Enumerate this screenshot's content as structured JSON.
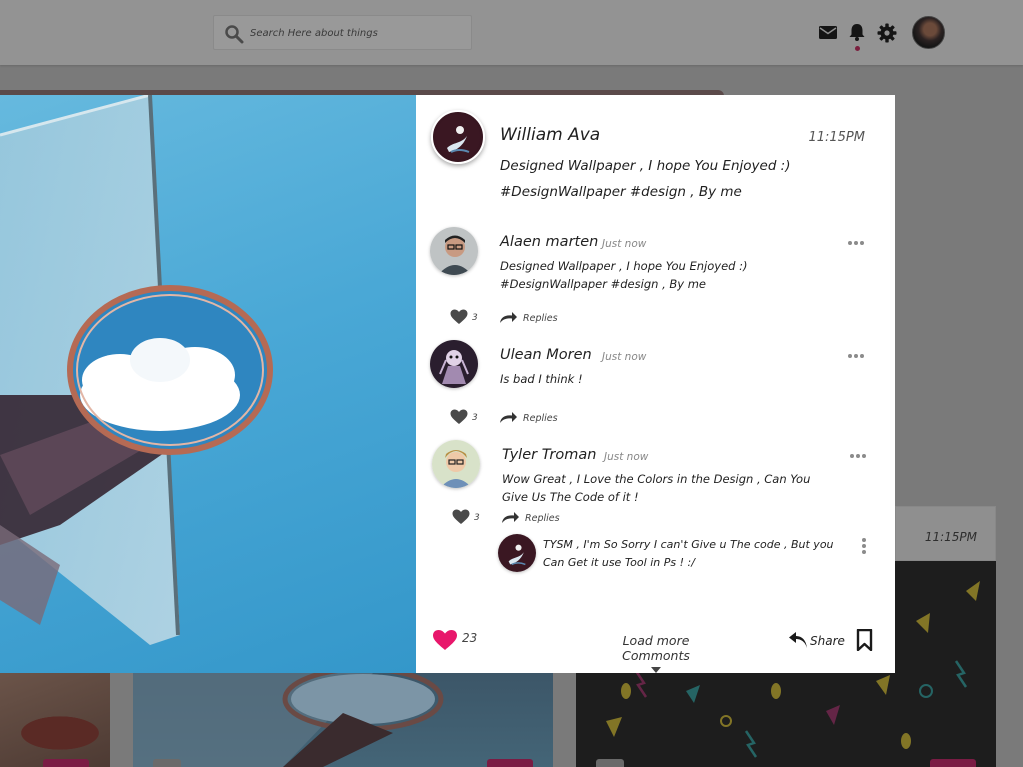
{
  "header": {
    "search_placeholder": "Search Here about things",
    "icons": [
      "mail-icon",
      "bell-icon",
      "gear-icon"
    ],
    "notification_dot_color": "#7a1f3e"
  },
  "post": {
    "author": "William Ava",
    "time": "11:15PM",
    "text": "Designed Wallpaper , I hope You Enjoyed :) #DesignWallpaper #design , By me",
    "likes": "23",
    "load_more": "Load more Commonts",
    "share_label": "Share",
    "accent_color": "#e8176b"
  },
  "comments": [
    {
      "name": "Alaen marten",
      "time": "Just now",
      "text": "Designed Wallpaper , I hope You Enjoyed :) #DesignWallpaper #design , By me",
      "likes": "3",
      "replies_label": "Replies"
    },
    {
      "name": "Ulean Moren",
      "time": "Just now",
      "text": "Is bad I think !",
      "likes": "3",
      "replies_label": "Replies"
    },
    {
      "name": "Tyler Troman",
      "time": "Just now",
      "text": "Wow Great , I Love the Colors in the Design , Can You Give Us The Code of it !",
      "likes": "3",
      "replies_label": "Replies",
      "reply": {
        "text": "TYSM , I'm So Sorry I can't Give u The code , But you Can Get it use Tool in Ps ! :/"
      }
    }
  ],
  "background": {
    "card_time": "11:15PM"
  }
}
